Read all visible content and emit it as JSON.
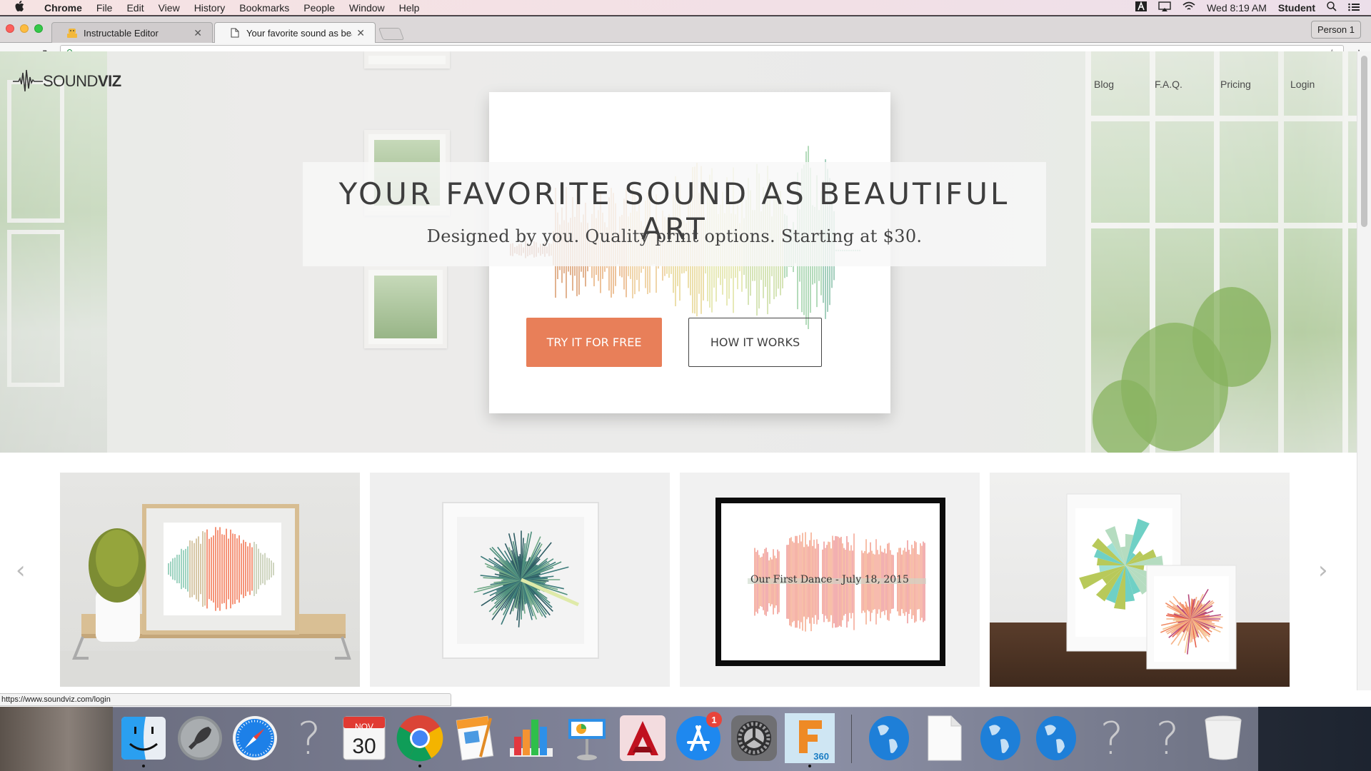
{
  "menubar": {
    "app": "Chrome",
    "items": [
      "File",
      "Edit",
      "View",
      "History",
      "Bookmarks",
      "People",
      "Window",
      "Help"
    ],
    "clock": "Wed 8:19 AM",
    "user": "Student"
  },
  "browser": {
    "tabs": [
      {
        "title": "Instructable Editor",
        "active": false
      },
      {
        "title": "Your favorite sound as beautiful art",
        "active": true
      }
    ],
    "profile_button": "Person 1",
    "url_scheme": "https://",
    "url_host": "www.soundviz.com",
    "status_url": "https://www.soundviz.com/login"
  },
  "page": {
    "logo": {
      "light": "SOUND",
      "bold": "VIZ"
    },
    "nav": [
      "Blog",
      "F.A.Q.",
      "Pricing",
      "Login"
    ],
    "headline": "YOUR FAVORITE SOUND AS BEAUTIFUL ART",
    "subheadline": "Designed by you. Quality print options. Starting at $30.",
    "cta_primary": "TRY IT FOR FREE",
    "cta_secondary": "HOW IT WORKS",
    "accent_color": "#e87f59",
    "carousel": {
      "prev": "‹",
      "next": "›",
      "slides": [
        {
          "alt": "Waveform print in wooden frame on shelf"
        },
        {
          "alt": "Radial green sound print in white frame"
        },
        {
          "alt": "Framed waveform print",
          "caption": "Our First Dance - July 18, 2015"
        },
        {
          "alt": "Two radial prints leaning on wall"
        }
      ]
    }
  },
  "dock": {
    "items": [
      {
        "name": "Finder",
        "running": true
      },
      {
        "name": "Launchpad"
      },
      {
        "name": "Safari"
      },
      {
        "name": "Unknown"
      },
      {
        "name": "Calendar",
        "month": "NOV",
        "day": "30"
      },
      {
        "name": "Chrome",
        "running": true
      },
      {
        "name": "Pages"
      },
      {
        "name": "Numbers"
      },
      {
        "name": "Keynote"
      },
      {
        "name": "AutoCAD"
      },
      {
        "name": "App Store",
        "badge": "1"
      },
      {
        "name": "System Preferences"
      },
      {
        "name": "Fusion 360",
        "label": "360",
        "running": true
      },
      {
        "name": "Web Location 1"
      },
      {
        "name": "Document"
      },
      {
        "name": "Web Location 2"
      },
      {
        "name": "Web Location 3"
      },
      {
        "name": "Unknown 2"
      },
      {
        "name": "Unknown 3"
      },
      {
        "name": "Trash"
      }
    ]
  }
}
